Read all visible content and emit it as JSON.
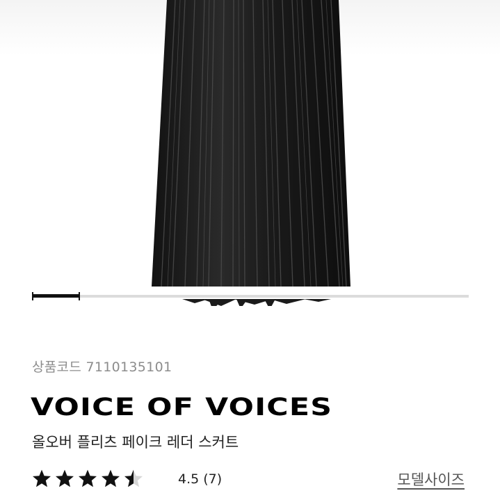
{
  "product": {
    "code": "상품코드 7110135101",
    "brand": "VOICE OF VOICES",
    "name": "올오버 플리츠 페이크 레더 스커트",
    "rating_text": "4.5 (7)",
    "rating_value": 4.5,
    "rating_max": 5,
    "model_size_label": "모델사이즈"
  },
  "gallery": {
    "image_icon": "pleated-skirt-image",
    "position_fraction": 0.11
  },
  "colors": {
    "star_filled": "#111111",
    "star_empty": "#d6d6d6",
    "skirt": "#1b1b1b"
  }
}
